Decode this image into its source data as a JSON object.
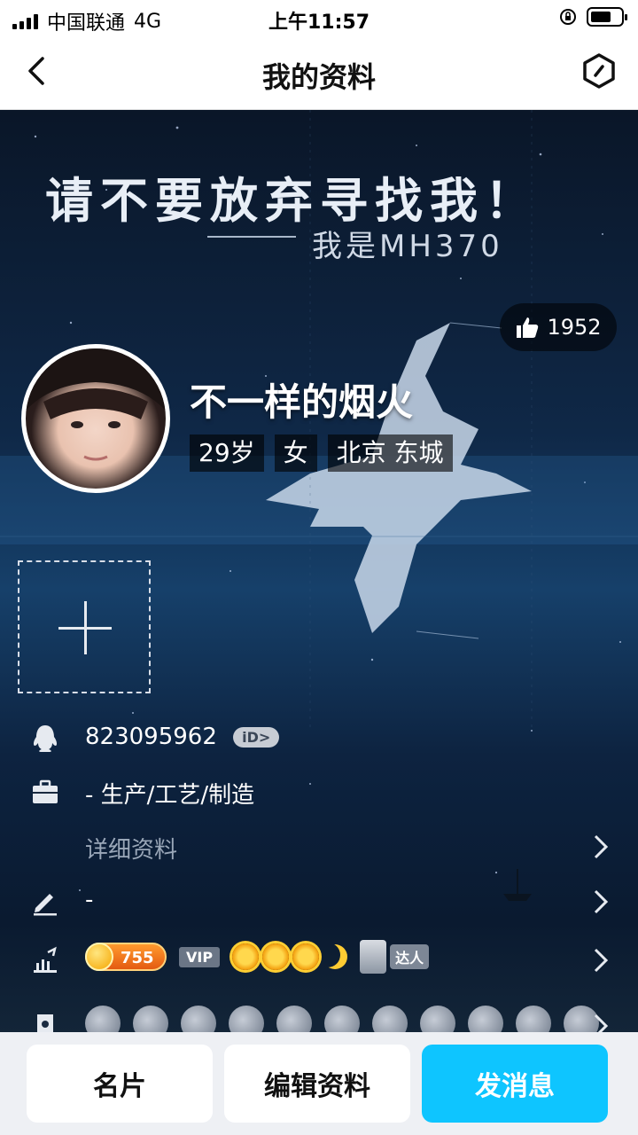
{
  "status_bar": {
    "carrier": "中国联通",
    "network": "4G",
    "time": "上午11:57"
  },
  "nav": {
    "title": "我的资料"
  },
  "banner": {
    "headline": "请不要放弃寻找我！",
    "subline": "我是MH370"
  },
  "profile": {
    "likes": "1952",
    "nickname": "不一样的烟火",
    "age": "29岁",
    "gender": "女",
    "location": "北京 东城"
  },
  "info": {
    "qq_number": "823095962",
    "id_badge": "iD>",
    "occupation": "- 生产/工艺/制造",
    "details_link": "详细资料",
    "signature": "-",
    "coin_value": "755",
    "vip_label": "VIP",
    "master_label": "达人"
  },
  "buttons": {
    "card": "名片",
    "edit": "编辑资料",
    "message": "发消息"
  },
  "colors": {
    "accent": "#0ec5ff",
    "background": "#0c1a2e"
  }
}
